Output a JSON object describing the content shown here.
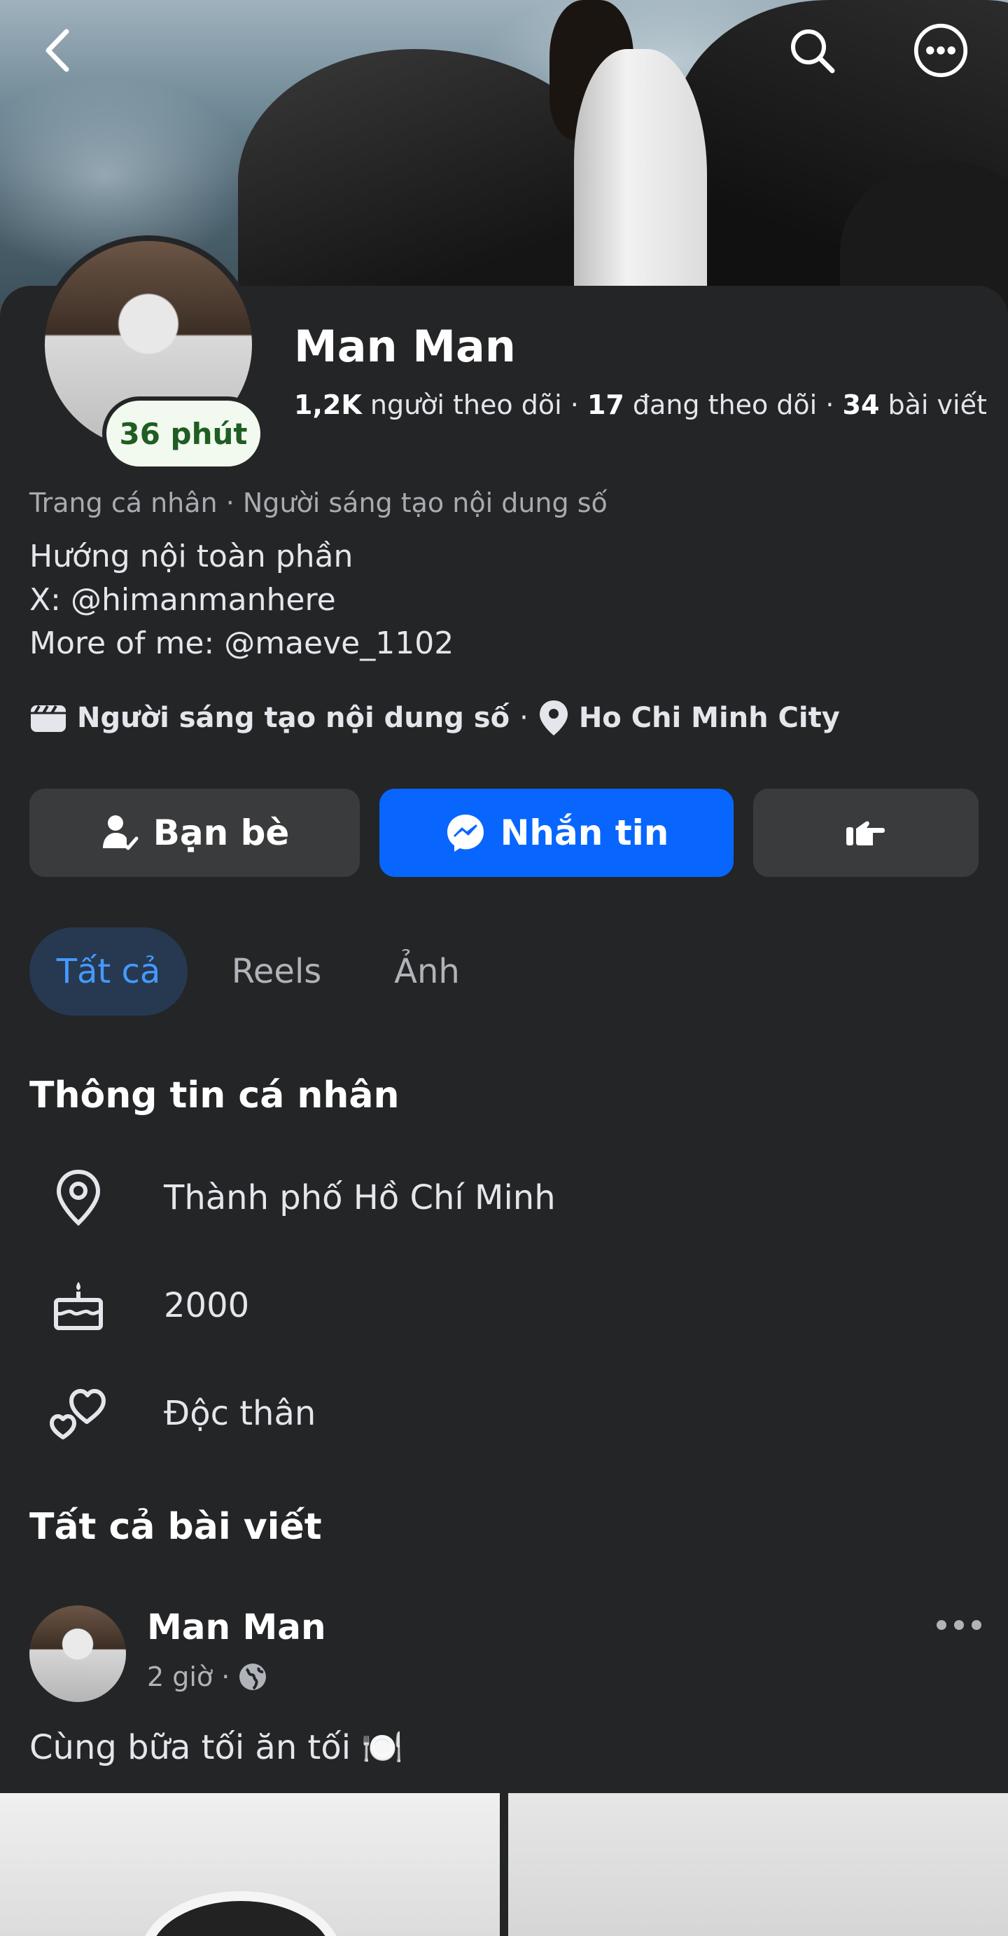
{
  "profile": {
    "name": "Man Man",
    "status_pill": "36 phút",
    "stats": {
      "followers_count": "1,2K",
      "followers_label": "người theo dõi",
      "following_count": "17",
      "following_label": "đang theo dõi",
      "posts_count": "34",
      "posts_label": "bài viết",
      "separator": "·"
    },
    "category_line": "Trang cá nhân · Người sáng tạo nội dung số",
    "bio_lines": [
      "Hướng nội toàn phần",
      "X: @himanmanhere",
      "More of me: @maeve_1102"
    ],
    "info": {
      "creator": "Người sáng tạo nội dung số",
      "separator": "·",
      "city": "Ho Chi Minh City"
    }
  },
  "actions": {
    "friends_label": "Bạn bè",
    "message_label": "Nhắn tin"
  },
  "tabs": [
    {
      "label": "Tất cả",
      "active": true
    },
    {
      "label": "Reels",
      "active": false
    },
    {
      "label": "Ảnh",
      "active": false
    }
  ],
  "personal_info": {
    "title": "Thông tin cá nhân",
    "items": [
      {
        "icon": "location-pin-icon",
        "text": "Thành phố Hồ Chí Minh"
      },
      {
        "icon": "birthday-cake-icon",
        "text": "2000"
      },
      {
        "icon": "hearts-icon",
        "text": "Độc thân"
      }
    ]
  },
  "posts": {
    "title": "Tất cả bài viết",
    "first_post": {
      "author": "Man Man",
      "time": "2 giờ",
      "separator": "·",
      "privacy_icon": "globe-icon",
      "text": "Cùng bữa tối ăn tối 🍽️"
    }
  },
  "colors": {
    "background": "#242527",
    "primary_button": "#0866ff",
    "secondary_button": "#3a3b3c",
    "active_tab_bg": "#263951",
    "active_tab_text": "#4599ff",
    "status_pill_bg": "#f2f9ef"
  }
}
